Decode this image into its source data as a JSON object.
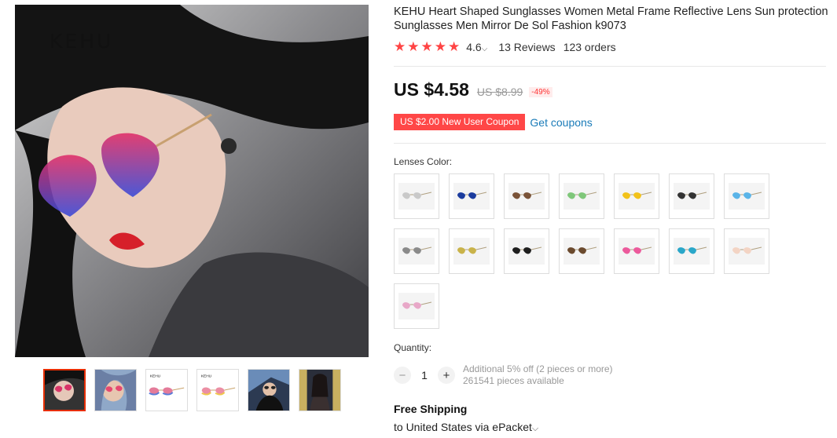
{
  "gallery": {
    "brand": "KEHU",
    "thumbnails": [
      "thumb-1",
      "thumb-2",
      "thumb-3",
      "thumb-4",
      "thumb-5",
      "thumb-6"
    ]
  },
  "product": {
    "title": "KEHU Heart Shaped Sunglasses Women Metal Frame Reflective Lens Sun protection Sunglasses Men Mirror De Sol Fashion k9073",
    "rating": "4.6",
    "reviews": "13 Reviews",
    "orders": "123 orders",
    "price": "US $4.58",
    "old_price": "US $8.99",
    "discount": "-49%",
    "coupon": "US $2.00 New User Coupon",
    "get_coupons": "Get coupons"
  },
  "options": {
    "lens_label": "Lenses Color:",
    "swatch_colors": [
      "#c9c9c9",
      "#1b3c9e",
      "#7a5338",
      "#7fc77a",
      "#f2c21a",
      "#333333",
      "#5ab4e8",
      "#8a8a8a",
      "#c9b34a",
      "#1e1e1e",
      "#6b4a2e",
      "#ec5a9c",
      "#2aa7c9",
      "#f3d4c4",
      "#e8a8c8"
    ]
  },
  "quantity": {
    "label": "Quantity:",
    "value": "1",
    "minus": "−",
    "plus": "+",
    "additional": "Additional 5% off (2 pieces or more)",
    "available": "261541 pieces available"
  },
  "shipping": {
    "title": "Free Shipping",
    "to": "to United States via ePacket"
  },
  "colors": {
    "accent": "#ff4747",
    "link": "#1a7bb8",
    "star": "#ff4747"
  }
}
